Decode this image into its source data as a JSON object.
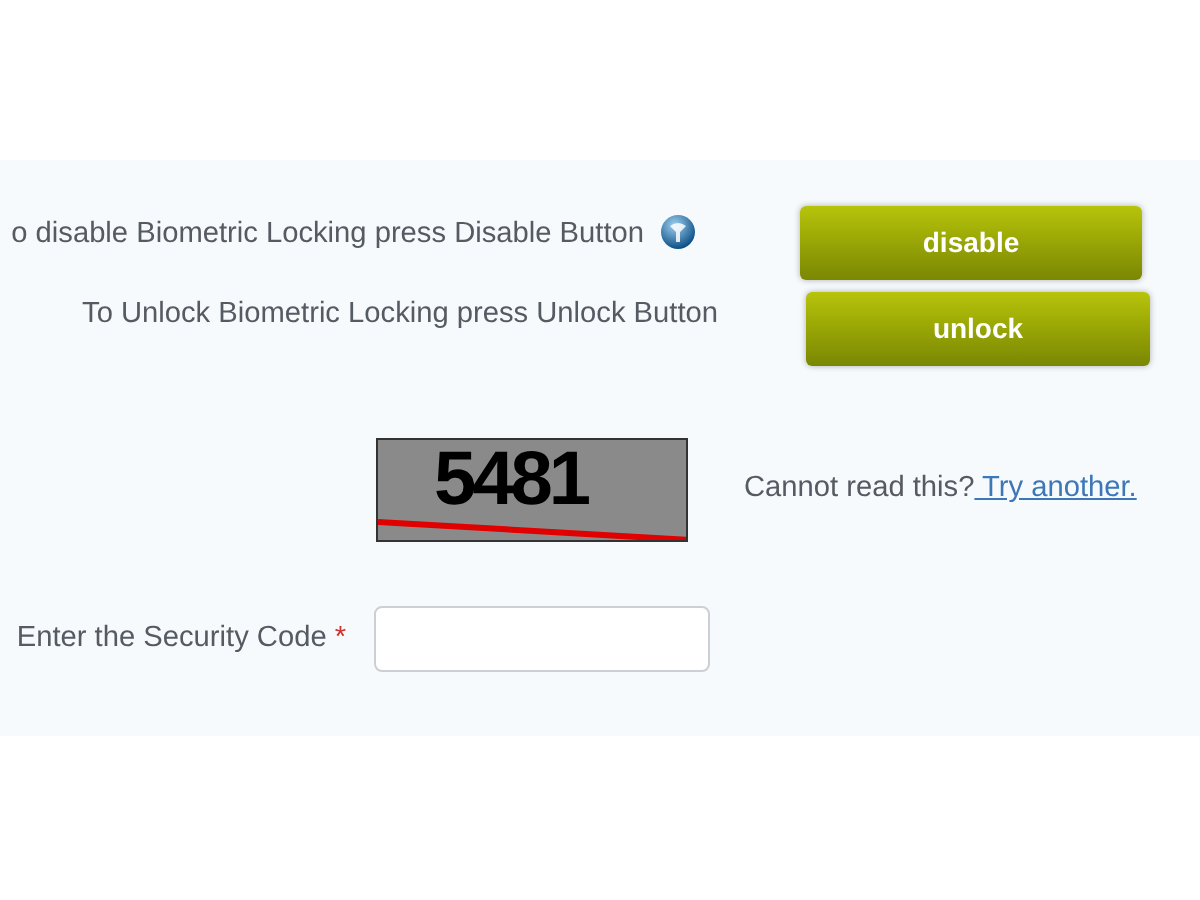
{
  "disable_row": {
    "instruction": "o disable Biometric Locking press Disable Button",
    "button": "disable"
  },
  "unlock_row": {
    "instruction": "To Unlock Biometric Locking press Unlock Button",
    "button": "unlock"
  },
  "captcha": {
    "code": "5481",
    "prompt": "Cannot read this?",
    "link": " Try another."
  },
  "security_code": {
    "label": "Enter the Security Code",
    "required_mark": "*"
  }
}
